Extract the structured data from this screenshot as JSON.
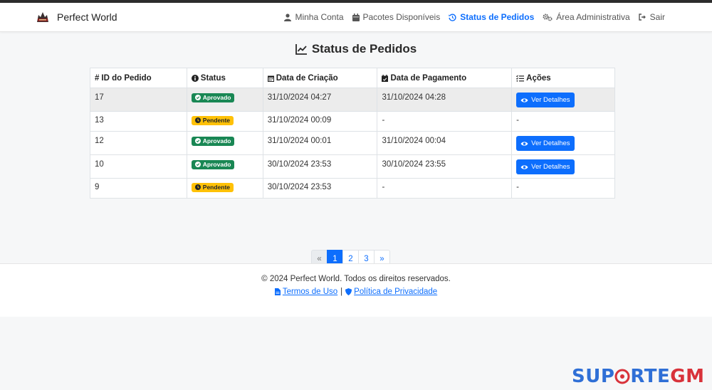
{
  "brand": {
    "name": "Perfect World"
  },
  "nav": {
    "items": [
      {
        "label": "Minha Conta",
        "icon": "user-icon",
        "active": false
      },
      {
        "label": "Pacotes Disponíveis",
        "icon": "calendar-icon",
        "active": false
      },
      {
        "label": "Status de Pedidos",
        "icon": "history-icon",
        "active": true
      },
      {
        "label": "Área Administrativa",
        "icon": "gears-icon",
        "active": false
      },
      {
        "label": "Sair",
        "icon": "sign-out-icon",
        "active": false
      }
    ]
  },
  "page": {
    "title": "Status de Pedidos"
  },
  "table": {
    "headers": {
      "id": "ID do Pedido",
      "status": "Status",
      "created": "Data de Criação",
      "paid": "Data de Pagamento",
      "actions": "Ações"
    },
    "rows": [
      {
        "id": "17",
        "status": "Aprovado",
        "created": "31/10/2024 04:27",
        "paid": "31/10/2024 04:28",
        "action": "Ver Detalhes"
      },
      {
        "id": "13",
        "status": "Pendente",
        "created": "31/10/2024 00:09",
        "paid": "-",
        "action": "-"
      },
      {
        "id": "12",
        "status": "Aprovado",
        "created": "31/10/2024 00:01",
        "paid": "31/10/2024 00:04",
        "action": "Ver Detalhes"
      },
      {
        "id": "10",
        "status": "Aprovado",
        "created": "30/10/2024 23:53",
        "paid": "30/10/2024 23:55",
        "action": "Ver Detalhes"
      },
      {
        "id": "9",
        "status": "Pendente",
        "created": "30/10/2024 23:53",
        "paid": "-",
        "action": "-"
      }
    ]
  },
  "pagination": {
    "prev": "«",
    "pages": [
      "1",
      "2",
      "3"
    ],
    "next": "»",
    "current": "1"
  },
  "footer": {
    "copyright": "© 2024 Perfect World. Todos os direitos reservados.",
    "terms": "Termos de Uso",
    "separator": "|",
    "privacy": "Política de Privacidade"
  },
  "watermark": {
    "part1": "SUP",
    "part2": "RTE",
    "part3": "GM"
  },
  "colors": {
    "primary": "#0d6efd",
    "success": "#198754",
    "warning": "#ffc107"
  }
}
